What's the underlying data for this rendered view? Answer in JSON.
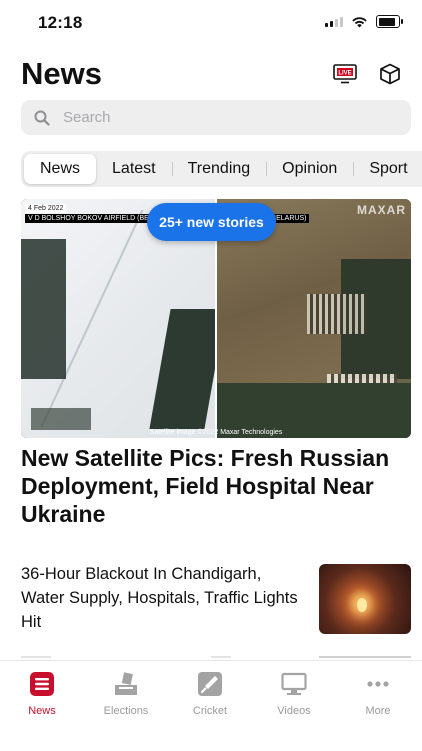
{
  "status_bar": {
    "time": "12:18"
  },
  "header": {
    "title": "News",
    "live_badge": "LIVE"
  },
  "search": {
    "placeholder": "Search"
  },
  "tabs": [
    {
      "label": "News",
      "active": true
    },
    {
      "label": "Latest"
    },
    {
      "label": "Trending"
    },
    {
      "label": "Opinion"
    },
    {
      "label": "Sport"
    }
  ],
  "new_stories_pill": "25+ new stories",
  "hero": {
    "image_date": "4 Feb 2022",
    "image_caption_left": "V D BOLSHOY BOKOV AIRFIELD (BELARUS)",
    "image_caption_right": "OV AIRFIELD (BELARUS)",
    "image_brand": "MAXAR",
    "image_credit": "Satellite image ©2022 Maxar Technologies",
    "headline": "New Satellite Pics: Fresh Russian Deployment, Field Hospital Near Ukraine"
  },
  "stories": [
    {
      "title": "36-Hour Blackout In Chandigarh, Water Supply, Hospitals, Traffic Lights Hit"
    }
  ],
  "bottom_tabs": [
    {
      "label": "News",
      "icon": "news-icon",
      "active": true
    },
    {
      "label": "Elections",
      "icon": "ballot-box-icon"
    },
    {
      "label": "Cricket",
      "icon": "cricket-bat-icon"
    },
    {
      "label": "Videos",
      "icon": "monitor-icon"
    },
    {
      "label": "More",
      "icon": "more-dots-icon"
    }
  ],
  "colors": {
    "accent": "#c8102e",
    "pill": "#1a73e8",
    "inactive": "#9b9b9b"
  }
}
